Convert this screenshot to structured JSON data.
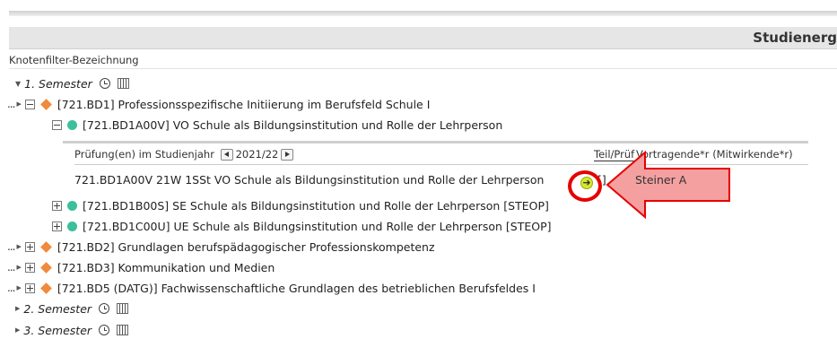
{
  "header": {
    "title": "Studienerg"
  },
  "filter": {
    "label": "Knotenfilter-Bezeichnung"
  },
  "semesters": [
    {
      "label": "1. Semester"
    },
    {
      "label": "2. Semester"
    },
    {
      "label": "3. Semester"
    }
  ],
  "nodes": {
    "bd1": "[721.BD1] Professionsspezifische Initiierung im Berufsfeld Schule I",
    "a00v": "[721.BD1A00V] VO Schule als Bildungsinstitution und Rolle der Lehrperson",
    "b00s": "[721.BD1B00S] SE Schule als Bildungsinstitution und Rolle der Lehrperson [STEOP]",
    "c00u": "[721.BD1C00U] UE Schule als Bildungsinstitution und Rolle der Lehrperson [STEOP]",
    "bd2": "[721.BD2] Grundlagen berufspädagogischer Professionskompetenz",
    "bd3": "[721.BD3] Kommunikation und Medien",
    "bd5": "[721.BD5 (DATG)] Fachwissenschaftliche Grundlagen des betrieblichen Berufsfeldes I"
  },
  "exam_panel": {
    "header_label": "Prüfung(en) im Studienjahr",
    "year": "2021/22",
    "col_teilpruef": "Teil/Prüf",
    "col_vortragende": "Vortragende*r (Mitwirkende*r)",
    "course_entry": "721.BD1A00V 21W 1SSt VO Schule als Bildungsinstitution und Rolle der Lehrperson",
    "bracket": "[]",
    "lecturer": "Steiner A"
  },
  "tree_prefix": "...",
  "colors": {
    "module_diamond": "#f08a3c",
    "course_dot": "#3cbf9a",
    "go_button": "#d4e830",
    "annotation_red": "#e60000",
    "arrow_fill": "#f4a0a0"
  },
  "icons": [
    "clock-icon",
    "calendar-icon",
    "expand-icon",
    "collapse-icon",
    "go-arrow-icon",
    "pointer-arrow"
  ]
}
